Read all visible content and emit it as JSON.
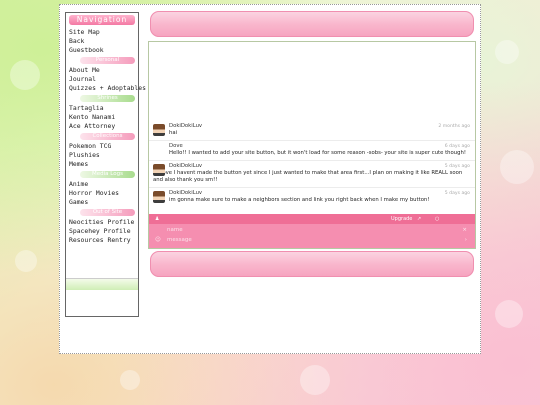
{
  "sidebar": {
    "title": "Navigation",
    "links_top": [
      "Site Map",
      "Back",
      "Guestbook"
    ],
    "sections": [
      {
        "label": "Personal",
        "color": "pink",
        "links": [
          "About Me",
          "Journal",
          "Quizzes + Adoptables"
        ]
      },
      {
        "label": "Shrines",
        "color": "green",
        "links": [
          "Tartaglia",
          "Kento Nanami",
          "Ace Attorney"
        ]
      },
      {
        "label": "Collections",
        "color": "pink",
        "links": [
          "Pokemon TCG",
          "Plushies",
          "Memes"
        ]
      },
      {
        "label": "Media Logs",
        "color": "green",
        "links": [
          "Anime",
          "Horror Movies",
          "Games"
        ]
      },
      {
        "label": "Out of Site",
        "color": "pink",
        "links": [
          "Neocities Profile",
          "Spacehey Profile",
          "Resources Rentry"
        ]
      }
    ]
  },
  "chat": {
    "messages": [
      {
        "name": "DokiDokiLuv",
        "time": "2 months ago",
        "body": "hai",
        "avatar": true
      },
      {
        "name": "Dove",
        "time": "6 days ago",
        "body": "Hello!! I wanted to add your site button, but it won't load for some reason -sobs- your site is super cute though!",
        "avatar": false
      },
      {
        "name": "DokiDokiLuv",
        "time": "5 days ago",
        "body": "@Dove I havent made the button yet since I just wanted to make that area first...I plan on making it like REALL soon and also thank you sm!!",
        "avatar": true
      },
      {
        "name": "DokiDokiLuv",
        "time": "5 days ago",
        "body": "im gonna make sure to make a neighbors section and link you right back when I make my button!",
        "avatar": true
      }
    ],
    "bar": {
      "user_icon": "user-icon",
      "upgrade_label": "Upgrade",
      "external_icon": "external-link-icon",
      "options_icon": "options-icon"
    },
    "form": {
      "name_placeholder": "name",
      "message_placeholder": "message",
      "smile_icon": "smiley-icon"
    }
  },
  "colors": {
    "accent_pink": "#ef6e96",
    "form_pink": "#f58eb0",
    "pill_pink": "#f9b7cd",
    "green": "#a9dc8e"
  }
}
